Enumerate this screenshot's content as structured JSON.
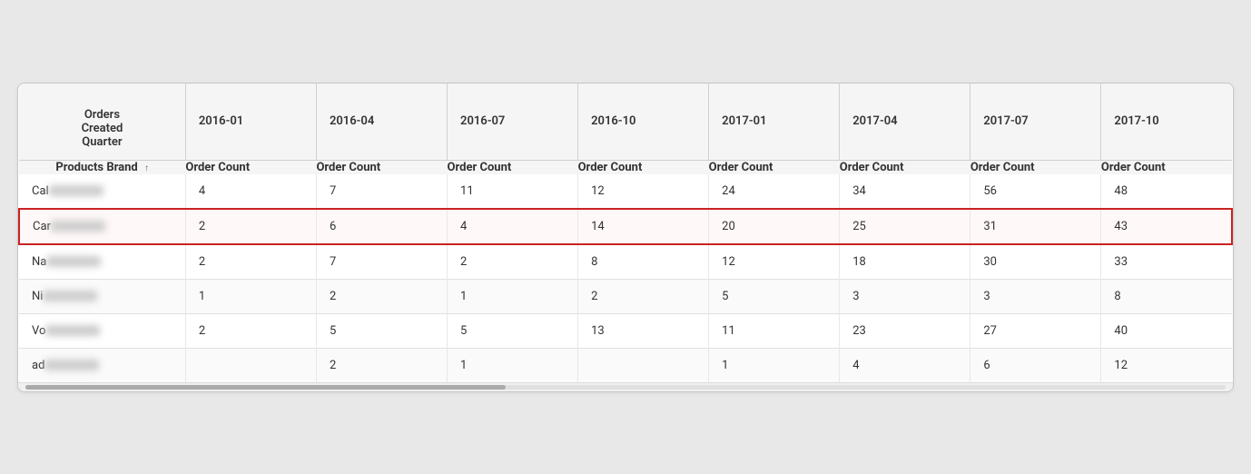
{
  "table": {
    "header_row1": {
      "col0": "Orders\nCreated\nQuarter",
      "col1": "2016-01",
      "col2": "2016-04",
      "col3": "2016-07",
      "col4": "2016-10",
      "col5": "2017-01",
      "col6": "2017-04",
      "col7": "2017-07",
      "col8": "2017-10"
    },
    "header_row2": {
      "col0": "Products Brand",
      "col0_sort": "↑",
      "col1": "Order Count",
      "col2": "Order Count",
      "col3": "Order Count",
      "col4": "Order Count",
      "col5": "Order Count",
      "col6": "Order Count",
      "col7": "Order Count",
      "col8": "Order Count"
    },
    "rows": [
      {
        "id": "row-cal",
        "brand": "Cal",
        "blurred": true,
        "highlighted": false,
        "values": [
          "4",
          "7",
          "11",
          "12",
          "24",
          "34",
          "56",
          "48"
        ]
      },
      {
        "id": "row-car",
        "brand": "Car",
        "blurred": true,
        "highlighted": true,
        "values": [
          "2",
          "6",
          "4",
          "14",
          "20",
          "25",
          "31",
          "43"
        ]
      },
      {
        "id": "row-na",
        "brand": "Na",
        "blurred": true,
        "highlighted": false,
        "values": [
          "2",
          "7",
          "2",
          "8",
          "12",
          "18",
          "30",
          "33"
        ]
      },
      {
        "id": "row-ni",
        "brand": "Ni",
        "blurred": true,
        "highlighted": false,
        "values": [
          "1",
          "2",
          "1",
          "2",
          "5",
          "3",
          "3",
          "8"
        ]
      },
      {
        "id": "row-vo",
        "brand": "Vo",
        "blurred": true,
        "highlighted": false,
        "values": [
          "2",
          "5",
          "5",
          "13",
          "11",
          "23",
          "27",
          "40"
        ]
      },
      {
        "id": "row-ad",
        "brand": "ad",
        "blurred": true,
        "highlighted": false,
        "values": [
          "",
          "2",
          "1",
          "",
          "1",
          "4",
          "6",
          "12"
        ]
      }
    ]
  }
}
